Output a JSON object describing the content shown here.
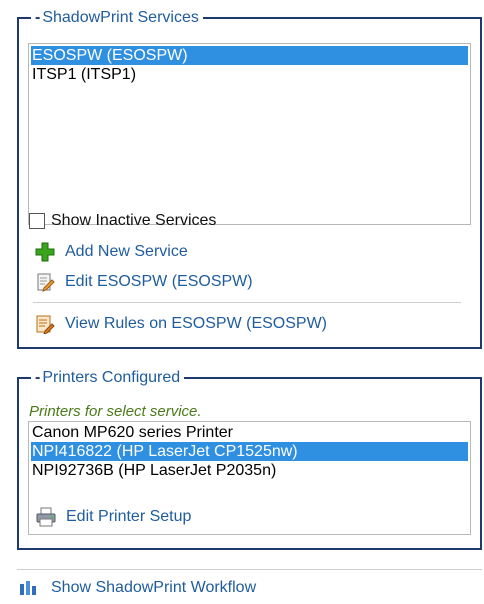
{
  "services_panel": {
    "title": "ShadowPrint Services",
    "items": [
      {
        "label": "ESOSPW (ESOSPW)",
        "selected": true
      },
      {
        "label": "ITSP1 (ITSP1)",
        "selected": false
      }
    ],
    "show_inactive": {
      "label": "Show Inactive Services",
      "checked": false
    },
    "actions": {
      "add": {
        "label": "Add New Service",
        "icon": "plus-icon"
      },
      "edit": {
        "label": "Edit ESOSPW (ESOSPW)",
        "icon": "edit-document-icon"
      },
      "rules": {
        "label": "View Rules on ESOSPW (ESOSPW)",
        "icon": "rules-icon"
      }
    }
  },
  "printers_panel": {
    "title": "Printers Configured",
    "note": "Printers for select service.",
    "items": [
      {
        "label": "Canon MP620 series Printer",
        "selected": false
      },
      {
        "label": "NPI416822 (HP LaserJet CP1525nw)",
        "selected": true
      },
      {
        "label": "NPI92736B (HP LaserJet P2035n)",
        "selected": false
      }
    ],
    "edit_setup": {
      "label": "Edit Printer Setup",
      "icon": "printer-icon"
    }
  },
  "workflow_link": {
    "label": "Show ShadowPrint Workflow",
    "icon": "workflow-chart-icon"
  },
  "colors": {
    "selection": "#2f8fe0",
    "link": "#1f5c9e",
    "panel_border": "#1d3a6e",
    "note": "#4a7a1a"
  }
}
